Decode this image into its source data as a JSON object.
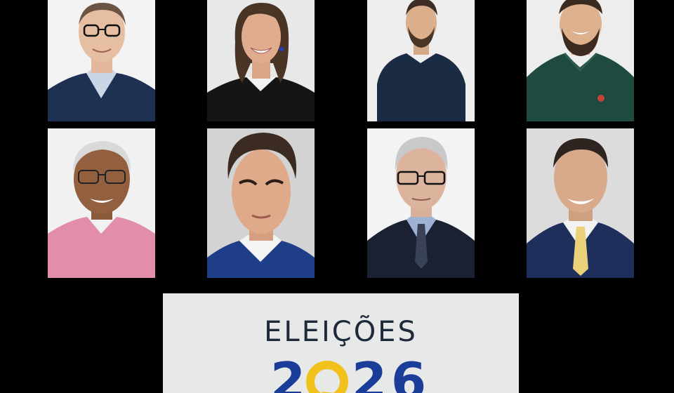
{
  "colors": {
    "background": "#000000",
    "banner_bg": "#e7e9e8",
    "title_color": "#1e2a3a",
    "year_blue": "#1b3d9a",
    "year_yellow": "#f1c21b"
  },
  "banner": {
    "title": "ELEIÇÕES",
    "year_digits": [
      "2",
      "",
      "2",
      "6"
    ]
  }
}
